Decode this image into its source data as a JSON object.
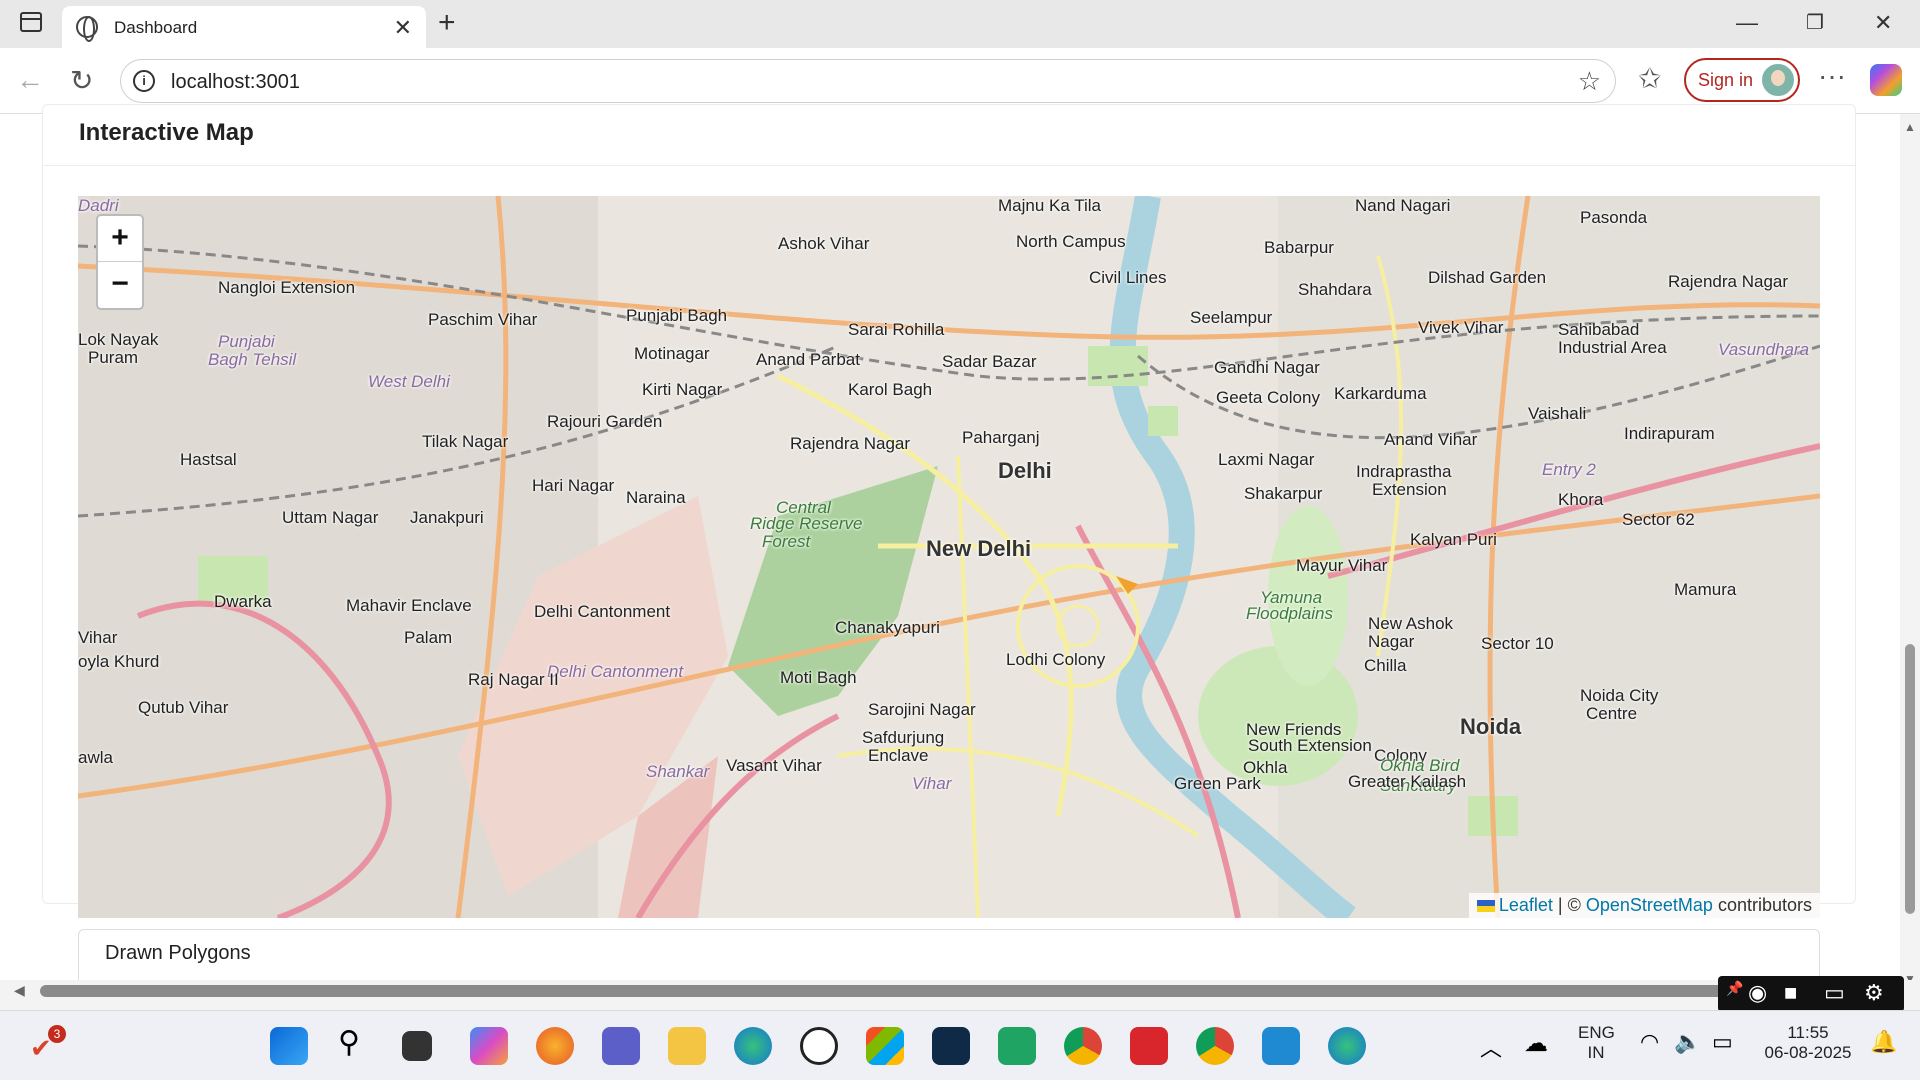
{
  "browser": {
    "tab_title": "Dashboard",
    "url": "localhost:3001",
    "signin_label": "Sign in"
  },
  "card": {
    "title": "Interactive Map"
  },
  "map": {
    "zoom_in": "+",
    "zoom_out": "−",
    "attribution_leaflet": "Leaflet",
    "attribution_sep": " | © ",
    "attribution_osm": "OpenStreetMap",
    "attribution_tail": " contributors",
    "labels": [
      {
        "text": "Majnu Ka Tila",
        "cls": ""
      },
      {
        "text": "Nand Nagari",
        "cls": ""
      },
      {
        "text": "Pasonda",
        "cls": ""
      },
      {
        "text": "Ashok Vihar",
        "cls": ""
      },
      {
        "text": "North Campus",
        "cls": ""
      },
      {
        "text": "Babarpur",
        "cls": ""
      },
      {
        "text": "Civil Lines",
        "cls": ""
      },
      {
        "text": "Dilshad Garden",
        "cls": ""
      },
      {
        "text": "Rajendra Nagar",
        "cls": ""
      },
      {
        "text": "Nangloi Extension",
        "cls": ""
      },
      {
        "text": "Shahdara",
        "cls": ""
      },
      {
        "text": "Paschim Vihar",
        "cls": ""
      },
      {
        "text": "Punjabi Bagh",
        "cls": ""
      },
      {
        "text": "Seelampur",
        "cls": ""
      },
      {
        "text": "Sarai Rohilla",
        "cls": ""
      },
      {
        "text": "Vivek Vihar",
        "cls": ""
      },
      {
        "text": "Sahibabad",
        "cls": ""
      },
      {
        "text": "Industrial Area",
        "cls": ""
      },
      {
        "text": "Vasundhara",
        "cls": "lbl-purple"
      },
      {
        "text": "Lok Nayak",
        "cls": ""
      },
      {
        "text": "Puram",
        "cls": ""
      },
      {
        "text": "Punjabi",
        "cls": "lbl-purple"
      },
      {
        "text": "Bagh Tehsil",
        "cls": "lbl-purple"
      },
      {
        "text": "Motinagar",
        "cls": ""
      },
      {
        "text": "Anand Parbat",
        "cls": ""
      },
      {
        "text": "Sadar Bazar",
        "cls": ""
      },
      {
        "text": "Gandhi Nagar",
        "cls": ""
      },
      {
        "text": "West Delhi",
        "cls": "lbl-purple"
      },
      {
        "text": "Kirti Nagar",
        "cls": ""
      },
      {
        "text": "Karol Bagh",
        "cls": ""
      },
      {
        "text": "Geeta Colony",
        "cls": ""
      },
      {
        "text": "Karkarduma",
        "cls": ""
      },
      {
        "text": "Vaishali",
        "cls": ""
      },
      {
        "text": "Rajouri Garden",
        "cls": ""
      },
      {
        "text": "Anand Vihar",
        "cls": ""
      },
      {
        "text": "Indirapuram",
        "cls": ""
      },
      {
        "text": "Tilak Nagar",
        "cls": ""
      },
      {
        "text": "Paharganj",
        "cls": ""
      },
      {
        "text": "Rajendra Nagar",
        "cls": ""
      },
      {
        "text": "Hastsal",
        "cls": ""
      },
      {
        "text": "Laxmi Nagar",
        "cls": ""
      },
      {
        "text": "Delhi",
        "cls": "lbl-big"
      },
      {
        "text": "Indraprastha",
        "cls": ""
      },
      {
        "text": "Entry 2",
        "cls": "lbl-purple"
      },
      {
        "text": "Hari Nagar",
        "cls": ""
      },
      {
        "text": "Extension",
        "cls": ""
      },
      {
        "text": "Shakarpur",
        "cls": ""
      },
      {
        "text": "Khora",
        "cls": ""
      },
      {
        "text": "Naraina",
        "cls": ""
      },
      {
        "text": "Central",
        "cls": "lbl-green"
      },
      {
        "text": "Uttam Nagar",
        "cls": ""
      },
      {
        "text": "Janakpuri",
        "cls": ""
      },
      {
        "text": "Ridge Reserve",
        "cls": "lbl-green"
      },
      {
        "text": "Sector 62",
        "cls": ""
      },
      {
        "text": "Forest",
        "cls": "lbl-green"
      },
      {
        "text": "Kalyan Puri",
        "cls": ""
      },
      {
        "text": "New Delhi",
        "cls": "lbl-big"
      },
      {
        "text": "Mayur Vihar",
        "cls": ""
      },
      {
        "text": "Mamura",
        "cls": ""
      },
      {
        "text": "Dwarka",
        "cls": ""
      },
      {
        "text": "Yamuna",
        "cls": "lbl-green"
      },
      {
        "text": "Mahavir Enclave",
        "cls": ""
      },
      {
        "text": "Floodplains",
        "cls": "lbl-green"
      },
      {
        "text": "Delhi Cantonment",
        "cls": ""
      },
      {
        "text": "New Ashok",
        "cls": ""
      },
      {
        "text": "Chanakyapuri",
        "cls": ""
      },
      {
        "text": "Nagar",
        "cls": ""
      },
      {
        "text": "Vihar",
        "cls": ""
      },
      {
        "text": "Palam",
        "cls": ""
      },
      {
        "text": "Sector 10",
        "cls": ""
      },
      {
        "text": "Lodhi Colony",
        "cls": ""
      },
      {
        "text": "Chilla",
        "cls": ""
      },
      {
        "text": "Delhi Cantonment",
        "cls": "lbl-purple"
      },
      {
        "text": "Moti Bagh",
        "cls": ""
      },
      {
        "text": "Raj Nagar II",
        "cls": ""
      },
      {
        "text": "oyla Khurd",
        "cls": ""
      },
      {
        "text": "Noida City",
        "cls": ""
      },
      {
        "text": "Qutub Vihar",
        "cls": ""
      },
      {
        "text": "Centre",
        "cls": ""
      },
      {
        "text": "Sarojini Nagar",
        "cls": ""
      },
      {
        "text": "Noida",
        "cls": "lbl-big"
      },
      {
        "text": "New Friends",
        "cls": ""
      },
      {
        "text": "Safdurjung",
        "cls": ""
      },
      {
        "text": "South Extension",
        "cls": ""
      },
      {
        "text": "Colony",
        "cls": ""
      },
      {
        "text": "Enclave",
        "cls": ""
      },
      {
        "text": "awla",
        "cls": ""
      },
      {
        "text": "Okhla",
        "cls": ""
      },
      {
        "text": "Vasant Vihar",
        "cls": ""
      },
      {
        "text": "Okhla Bird",
        "cls": "lbl-green"
      },
      {
        "text": "Shankar",
        "cls": "lbl-purple"
      },
      {
        "text": "Sanctuary",
        "cls": "lbl-green"
      },
      {
        "text": "Vihar",
        "cls": "lbl-purple"
      },
      {
        "text": "Green Park",
        "cls": ""
      },
      {
        "text": "Greater Kailash",
        "cls": ""
      },
      {
        "text": "Dadri",
        "cls": "lbl-purple"
      }
    ]
  },
  "polygons_section": {
    "title": "Drawn Polygons"
  },
  "taskbar": {
    "notification_badge": "3",
    "lang_line1": "ENG",
    "lang_line2": "IN",
    "time": "11:55",
    "date": "06-08-2025"
  }
}
